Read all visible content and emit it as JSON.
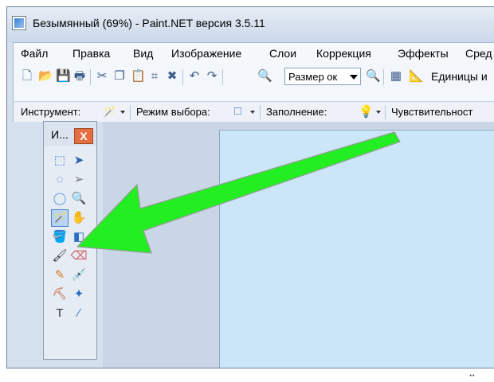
{
  "window": {
    "title": "Безымянный (69%) - Paint.NET версия 3.5.11"
  },
  "menu": {
    "items": [
      "Файл",
      "Правка",
      "Вид",
      "Изображение",
      "Слои",
      "Коррекция",
      "Эффекты",
      "Сред"
    ]
  },
  "toolbar": {
    "zoom_value": "Размер ок",
    "units_label": "Единицы и"
  },
  "tool_options": {
    "tool_label": "Инструмент:",
    "selection_mode_label": "Режим выбора:",
    "fill_label": "Заполнение:",
    "sensitivity_label": "Чувствительност"
  },
  "tools_panel": {
    "title": "И...",
    "close_label": "X"
  },
  "colors": {
    "arrow": "#22ee22",
    "canvas": "#cbe5f9",
    "close_button": "#e46f42"
  }
}
